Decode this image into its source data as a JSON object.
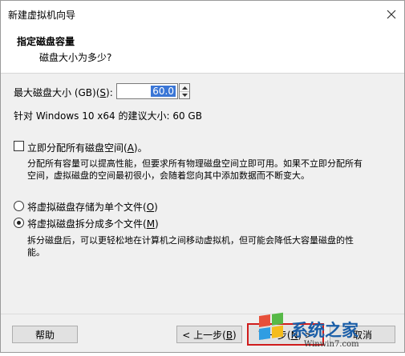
{
  "window": {
    "title": "新建虚拟机向导",
    "close_icon": "close-icon"
  },
  "header": {
    "title": "指定磁盘容量",
    "subtitle": "磁盘大小为多少?"
  },
  "disk": {
    "max_label": "最大磁盘大小 (GB)(",
    "max_key": "S",
    "max_label_end": "):",
    "value": "60.0",
    "recommend": "针对 Windows 10 x64 的建议大小: 60 GB"
  },
  "allocate": {
    "label": "立即分配所有磁盘空间(",
    "key": "A",
    "label_end": ")。",
    "checked": false,
    "desc_line1": "分配所有容量可以提高性能，但要求所有物理磁盘空间立即可用。如果不立即分配所有",
    "desc_line2": "空间，虚拟磁盘的空间最初很小，会随着您向其中添加数据而不断变大。"
  },
  "storage": {
    "single_label": "将虚拟磁盘存储为单个文件(",
    "single_key": "O",
    "single_end": ")",
    "multi_label": "将虚拟磁盘拆分成多个文件(",
    "multi_key": "M",
    "multi_end": ")",
    "selected": "multi",
    "multi_desc_line1": "拆分磁盘后，可以更轻松地在计算机之间移动虚拟机，但可能会降低大容量磁盘的性",
    "multi_desc_line2": "能。"
  },
  "buttons": {
    "help": "帮助",
    "back": "< 上一步(",
    "back_key": "B",
    "back_end": ")",
    "next": "下一步(",
    "next_key": "N",
    "next_end": ") >",
    "cancel": "取消"
  },
  "watermark": {
    "brand": "系统之家",
    "url": "Winwin7.com"
  },
  "colors": {
    "selection": "#3a76d6",
    "highlight_border": "#d01c1c"
  }
}
